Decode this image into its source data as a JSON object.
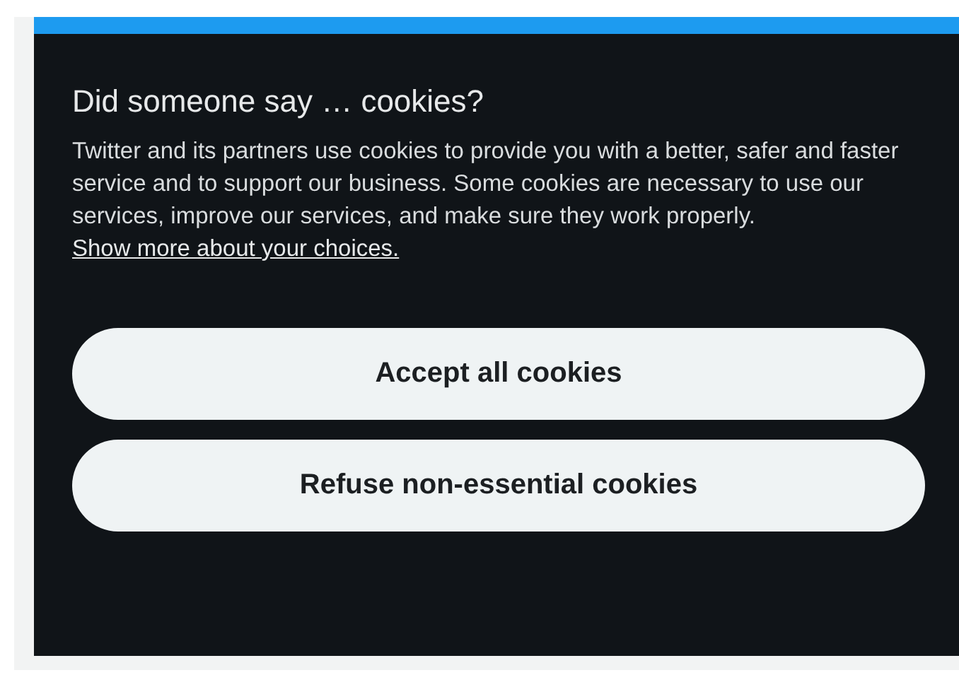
{
  "dialog": {
    "title": "Did someone say … cookies?",
    "body": "Twitter and its partners use cookies to provide you with a better, safer and faster service and to support our business. Some cookies are necessary to use our services, improve our services, and make sure they work properly.",
    "link": "Show more about your choices.",
    "buttons": [
      {
        "label": "Accept all cookies"
      },
      {
        "label": "Refuse non-essential cookies"
      }
    ]
  }
}
